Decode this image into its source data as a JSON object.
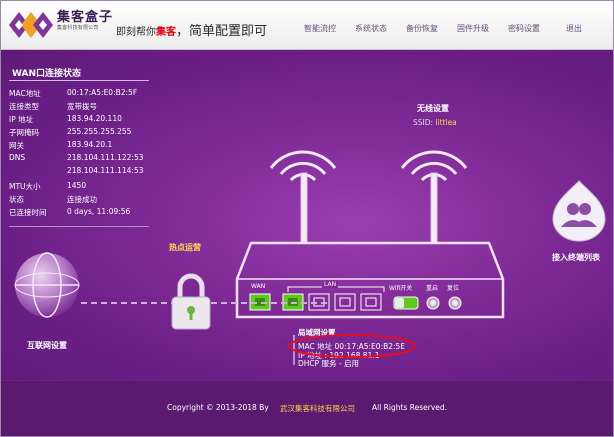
{
  "header": {
    "brand": "集客盒子",
    "brand_sub": "集客科技有限公司",
    "slogan_pre": "即刻帮你",
    "slogan_highlight": "集客",
    "slogan_post": "，简单配置即可",
    "nav": [
      "智能流控",
      "系统状态",
      "备份恢复",
      "固件升级",
      "密码设置",
      "退出"
    ]
  },
  "wan": {
    "title": "WAN口连接状态",
    "rows": [
      {
        "label": "MAC地址",
        "value": "00:17:A5:E0:B2:5F"
      },
      {
        "label": "连接类型",
        "value": "宽带拨号"
      },
      {
        "label": "IP 地址",
        "value": "183.94.20.110"
      },
      {
        "label": "子网掩码",
        "value": "255.255.255.255"
      },
      {
        "label": "网关",
        "value": "183.94.20.1"
      },
      {
        "label": "DNS",
        "value": "218.104.111.122:53"
      },
      {
        "label": "",
        "value": "218.104.111.114:53"
      },
      {
        "label": "MTU大小",
        "value": "1450"
      },
      {
        "label": "状态",
        "value": "连接成功"
      },
      {
        "label": "已连接时间",
        "value": "0 days, 11:09:56"
      }
    ]
  },
  "wireless": {
    "title": "无线设置",
    "ssid_label": "SSID:",
    "ssid_value": "littlea"
  },
  "hotspot": {
    "label": "热点运营"
  },
  "internet": {
    "label": "互联网设置"
  },
  "clients": {
    "label": "接入终端列表"
  },
  "router": {
    "wan_port": "WAN",
    "lan_ports": "LAN",
    "wifi_switch": "Wifi开关",
    "restart": "重启",
    "reset": "复位"
  },
  "lan": {
    "title": "局域网设置",
    "mac": "MAC 地址 00:17:A5:E0:B2:5E",
    "ip": "IP 地址 : 192.168.81.1",
    "dhcp": "DHCP 服务 - 启用"
  },
  "footer": {
    "copyright": "Copyright © 2013-2018 By",
    "company": "武汉集客科技有限公司",
    "rights": "All Rights Reserved."
  },
  "colors": {
    "accent_purple": "#7f2a97",
    "highlight_yellow": "#ffd24a",
    "port_green": "#5ec91e",
    "annotation_red": "#e0101e"
  }
}
